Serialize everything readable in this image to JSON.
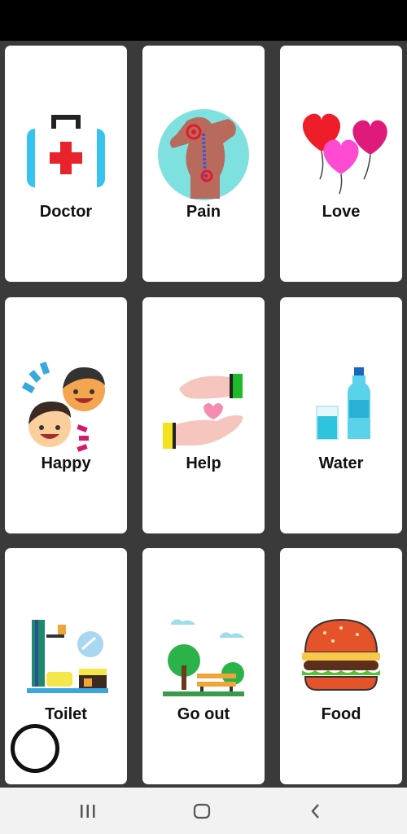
{
  "cards": [
    {
      "label": "Doctor",
      "icon": "doctor-kit-icon"
    },
    {
      "label": "Pain",
      "icon": "back-pain-icon"
    },
    {
      "label": "Love",
      "icon": "heart-balloons-icon"
    },
    {
      "label": "Happy",
      "icon": "happy-faces-icon"
    },
    {
      "label": "Help",
      "icon": "helping-hands-icon"
    },
    {
      "label": "Water",
      "icon": "water-bottle-icon"
    },
    {
      "label": "Toilet",
      "icon": "toilet-sink-icon"
    },
    {
      "label": "Go out",
      "icon": "park-bench-icon"
    },
    {
      "label": "Food",
      "icon": "burger-icon"
    }
  ],
  "nav": {
    "recent": "recent-apps-icon",
    "home": "home-icon",
    "back": "back-icon"
  },
  "colors": {
    "background": "#3a3a3a",
    "card": "#ffffff",
    "status_bar": "#000000",
    "nav_bar": "#f2f2f2"
  }
}
